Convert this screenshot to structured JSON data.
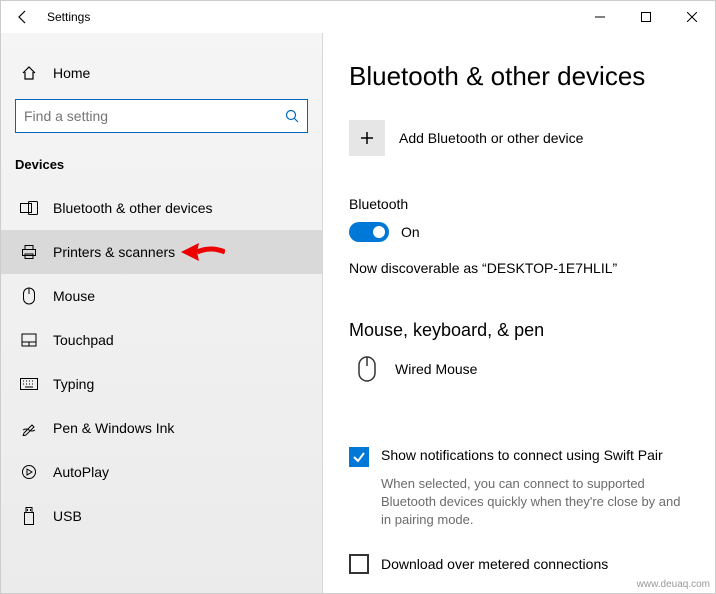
{
  "window": {
    "title": "Settings"
  },
  "sidebar": {
    "home": "Home",
    "search_placeholder": "Find a setting",
    "section": "Devices",
    "items": [
      {
        "label": "Bluetooth & other devices"
      },
      {
        "label": "Printers & scanners"
      },
      {
        "label": "Mouse"
      },
      {
        "label": "Touchpad"
      },
      {
        "label": "Typing"
      },
      {
        "label": "Pen & Windows Ink"
      },
      {
        "label": "AutoPlay"
      },
      {
        "label": "USB"
      }
    ]
  },
  "content": {
    "heading": "Bluetooth & other devices",
    "add_label": "Add Bluetooth or other device",
    "bt_label": "Bluetooth",
    "bt_state": "On",
    "discover": "Now discoverable as “DESKTOP-1E7HLIL”",
    "section2": "Mouse, keyboard, & pen",
    "device1": "Wired Mouse",
    "swift_label": "Show notifications to connect using Swift Pair",
    "swift_desc": "When selected, you can connect to supported Bluetooth devices quickly when they're close by and in pairing mode.",
    "metered_label": "Download over metered connections"
  },
  "watermark": "www.deuaq.com"
}
